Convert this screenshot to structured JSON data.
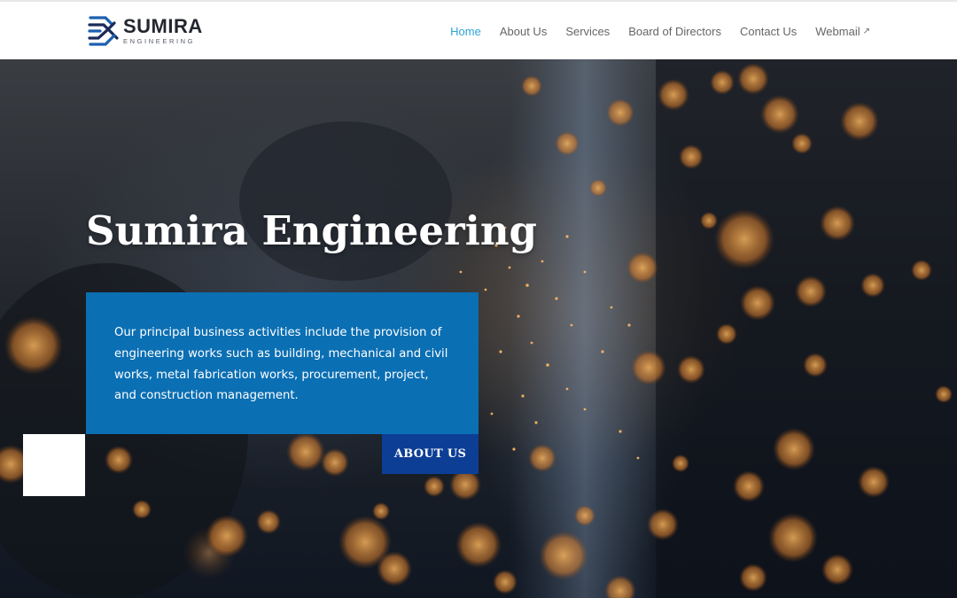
{
  "header": {
    "logo": {
      "name": "SUMIRA",
      "sub": "ENGINEERING",
      "mark_icon": "sumira-logo-mark"
    },
    "nav": [
      {
        "label": "Home",
        "active": true
      },
      {
        "label": "About Us",
        "active": false
      },
      {
        "label": "Services",
        "active": false
      },
      {
        "label": "Board of Directors",
        "active": false
      },
      {
        "label": "Contact Us",
        "active": false
      },
      {
        "label": "Webmail",
        "active": false,
        "external_icon": "external-link-icon",
        "external_glyph": "↗"
      }
    ]
  },
  "hero": {
    "title": "Sumira Engineering",
    "description": "Our principal business activities include the provision of engineering works such as building, mechanical and civil works, metal fabrication works, procurement, project, and construction management.",
    "button_label": "ABOUT US"
  },
  "colors": {
    "nav_active": "#2ea3d8",
    "nav_text": "#666666",
    "info_box": "#0b6fb3",
    "button": "#0d3e95",
    "logo_blue": "#1b5fb0",
    "logo_navy": "#1a2a5a",
    "sparks": "#e8903a"
  }
}
